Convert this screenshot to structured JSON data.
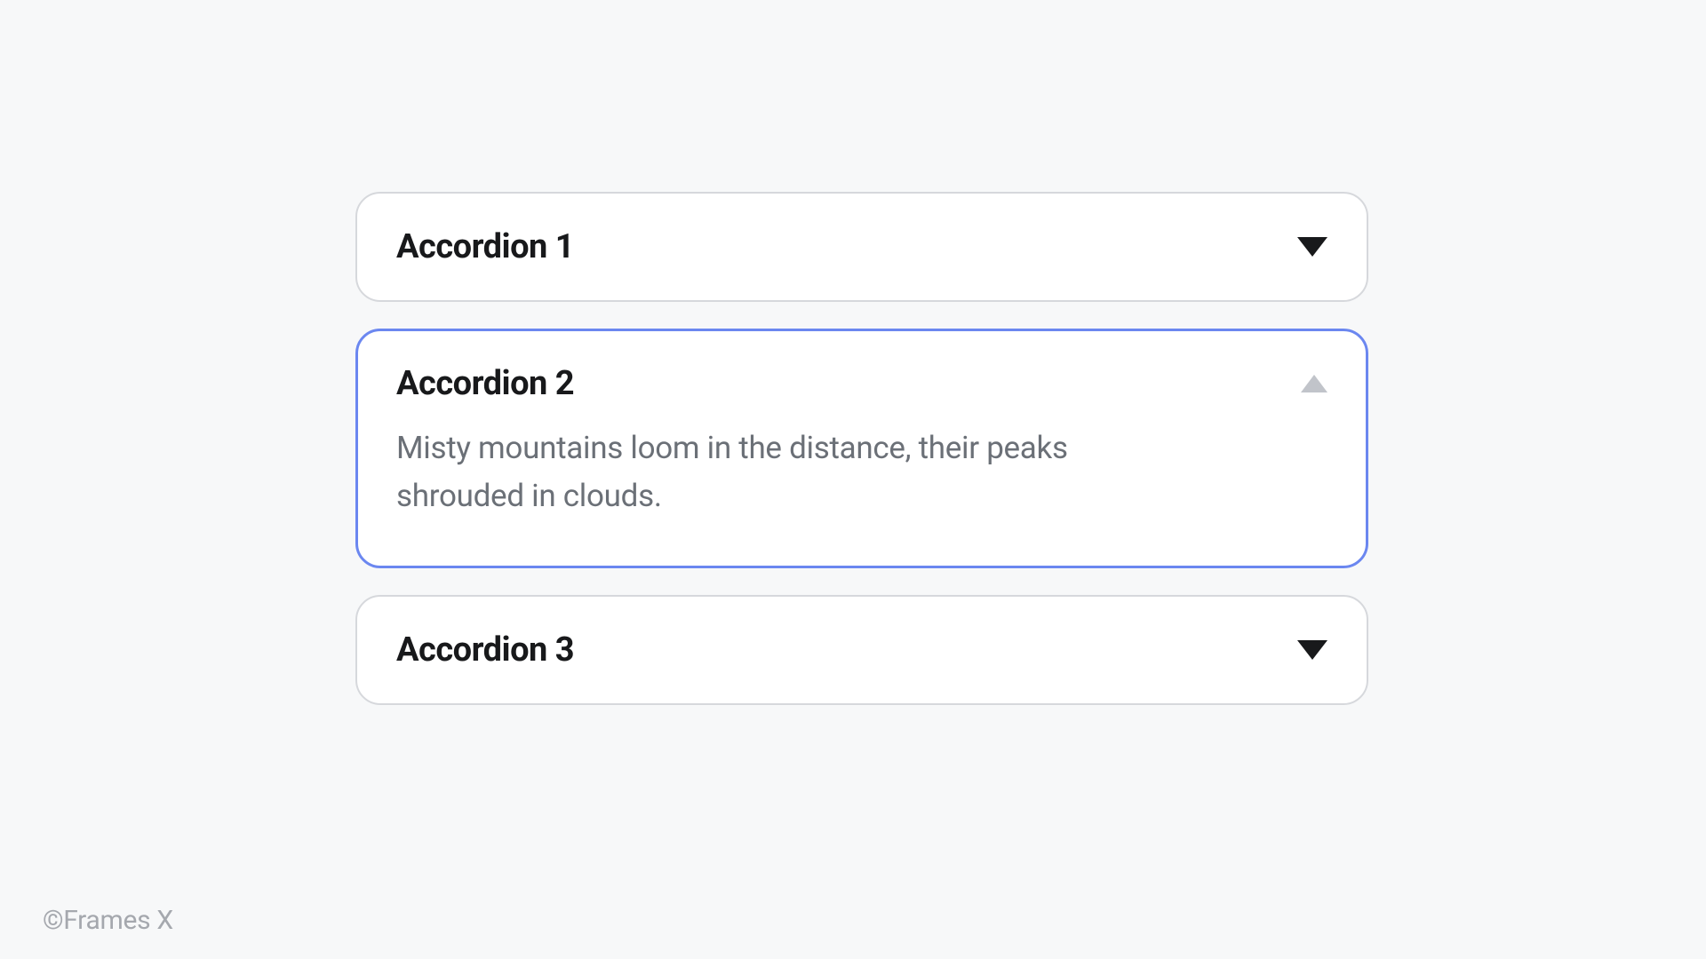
{
  "accordions": [
    {
      "title": "Accordion 1",
      "expanded": false
    },
    {
      "title": "Accordion 2",
      "expanded": true,
      "content": "Misty mountains loom in the distance, their peaks shrouded in clouds."
    },
    {
      "title": "Accordion 3",
      "expanded": false
    }
  ],
  "footer": "©Frames X"
}
